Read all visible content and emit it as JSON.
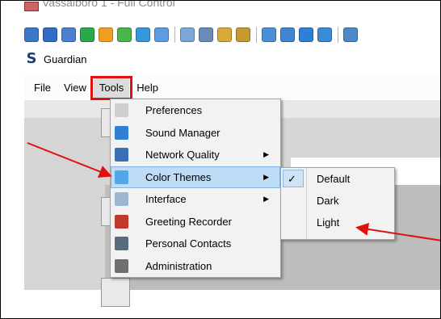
{
  "window": {
    "title": "Vassalboro 1 - Full Control"
  },
  "app": {
    "logo_glyph": "S",
    "name": "Guardian"
  },
  "toolbar": {
    "buttons": [
      {
        "icon": "monitor-icon",
        "color": "#3a78c8"
      },
      {
        "icon": "screen-icon",
        "color": "#2f6ec4"
      },
      {
        "icon": "terminal-icon",
        "color": "#4a7fd1"
      },
      {
        "icon": "transfer-arrows-icon",
        "color": "#2aa84a"
      },
      {
        "icon": "power-icon",
        "color": "#f0a020"
      },
      {
        "icon": "users-chat-icon",
        "color": "#48b64a"
      },
      {
        "icon": "phone-icon",
        "color": "#3498db"
      },
      {
        "icon": "message-icon",
        "color": "#5d9ce0"
      },
      {
        "icon": "upload-icon",
        "color": "#7aa6d8"
      },
      {
        "icon": "network-icon",
        "color": "#6b8ab5"
      },
      {
        "icon": "lock-icon",
        "color": "#d9a93a"
      },
      {
        "icon": "unlock-icon",
        "color": "#c49a2e"
      },
      {
        "icon": "window-icon",
        "color": "#4c8fd6"
      },
      {
        "icon": "settings-window-icon",
        "color": "#3f85cf"
      },
      {
        "icon": "blue-square-icon",
        "color": "#2f7fd4"
      },
      {
        "icon": "refresh-screen-icon",
        "color": "#3b8ad6"
      },
      {
        "icon": "copy-icon",
        "color": "#4d88c7"
      }
    ]
  },
  "menubar": {
    "items": [
      "File",
      "View",
      "Tools",
      "Help"
    ]
  },
  "tools_menu": {
    "items": [
      {
        "label": "Preferences",
        "icon": "preferences-icon",
        "color": "#cfcfcf",
        "has_submenu": false
      },
      {
        "label": "Sound Manager",
        "icon": "music-note-icon",
        "color": "#2f7fd4",
        "has_submenu": false
      },
      {
        "label": "Network Quality",
        "icon": "network-monitor-icon",
        "color": "#3b6fb5",
        "has_submenu": true
      },
      {
        "label": "Color Themes",
        "icon": "color-themes-icon",
        "color": "#4fa7e8",
        "has_submenu": true
      },
      {
        "label": "Interface",
        "icon": "interface-icon",
        "color": "#9fb6cf",
        "has_submenu": true
      },
      {
        "label": "Greeting Recorder",
        "icon": "greeting-recorder-icon",
        "color": "#c0392b",
        "has_submenu": false
      },
      {
        "label": "Personal Contacts",
        "icon": "personal-contacts-icon",
        "color": "#5a6b7d",
        "has_submenu": false
      },
      {
        "label": "Administration",
        "icon": "gear-icon",
        "color": "#6f6f6f",
        "has_submenu": false
      }
    ],
    "arrow_glyph": "▶"
  },
  "theme_menu": {
    "items": [
      {
        "label": "Default",
        "checked": true
      },
      {
        "label": "Dark",
        "checked": false
      },
      {
        "label": "Light",
        "checked": false
      }
    ],
    "check_glyph": "✓"
  },
  "colors": {
    "highlight_red": "#e01010",
    "arrow_red": "#e01010",
    "active_item_bg": "#bfdcf6"
  }
}
